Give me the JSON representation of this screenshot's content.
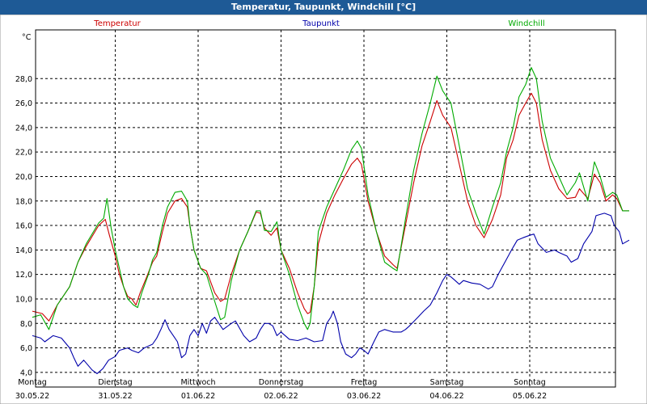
{
  "window": {
    "title": "Temperatur, Taupunkt, Windchill [°C]"
  },
  "chart_data": {
    "type": "line",
    "unit_label": "°C",
    "ylim": [
      3.0,
      30.5
    ],
    "y_ticks": [
      4.0,
      6.0,
      8.0,
      10.0,
      12.0,
      14.0,
      16.0,
      18.0,
      20.0,
      22.0,
      24.0,
      26.0,
      28.0
    ],
    "y_tick_labels": [
      "4,0",
      "6,0",
      "8,0",
      "10,0",
      "12,0",
      "14,0",
      "16,0",
      "18,0",
      "20,0",
      "22,0",
      "24,0",
      "26,0",
      "28,0"
    ],
    "xlim": [
      0,
      7.1
    ],
    "x_ticks": [
      {
        "x": 0,
        "day": "Montag",
        "date": "30.05.22"
      },
      {
        "x": 1,
        "day": "Dienstag",
        "date": "31.05.22"
      },
      {
        "x": 2,
        "day": "Mittwoch",
        "date": "01.06.22"
      },
      {
        "x": 3,
        "day": "Donnerstag",
        "date": "02.06.22"
      },
      {
        "x": 4,
        "day": "Freitag",
        "date": "03.06.22"
      },
      {
        "x": 5,
        "day": "Samstag",
        "date": "04.06.22"
      },
      {
        "x": 6,
        "day": "Sonntag",
        "date": "05.06.22"
      }
    ],
    "grid": true,
    "legend_placement": "top",
    "series": [
      {
        "name": "Temperatur",
        "color": "#cc0000",
        "points": [
          [
            0,
            9.0
          ],
          [
            0.12,
            8.8
          ],
          [
            0.2,
            8.2
          ],
          [
            0.3,
            9.5
          ],
          [
            0.45,
            11.0
          ],
          [
            0.55,
            13.0
          ],
          [
            0.65,
            14.3
          ],
          [
            0.8,
            16.0
          ],
          [
            0.88,
            16.5
          ],
          [
            0.93,
            15.2
          ],
          [
            1.0,
            13.5
          ],
          [
            1.05,
            12.0
          ],
          [
            1.1,
            11.0
          ],
          [
            1.15,
            10.2
          ],
          [
            1.2,
            10.0
          ],
          [
            1.25,
            9.5
          ],
          [
            1.3,
            10.5
          ],
          [
            1.38,
            11.8
          ],
          [
            1.45,
            13.0
          ],
          [
            1.5,
            13.5
          ],
          [
            1.57,
            15.5
          ],
          [
            1.63,
            17.0
          ],
          [
            1.72,
            18.0
          ],
          [
            1.8,
            18.2
          ],
          [
            1.87,
            17.5
          ],
          [
            1.9,
            16.0
          ],
          [
            1.95,
            14.0
          ],
          [
            2.03,
            12.5
          ],
          [
            2.1,
            12.3
          ],
          [
            2.2,
            10.5
          ],
          [
            2.27,
            9.8
          ],
          [
            2.32,
            10.0
          ],
          [
            2.4,
            12.0
          ],
          [
            2.5,
            14.0
          ],
          [
            2.6,
            15.5
          ],
          [
            2.7,
            17.1
          ],
          [
            2.75,
            17.0
          ],
          [
            2.8,
            15.8
          ],
          [
            2.88,
            15.2
          ],
          [
            2.95,
            15.8
          ],
          [
            3.0,
            14.0
          ],
          [
            3.1,
            12.5
          ],
          [
            3.2,
            10.5
          ],
          [
            3.28,
            9.2
          ],
          [
            3.32,
            8.8
          ],
          [
            3.35,
            8.9
          ],
          [
            3.4,
            11.0
          ],
          [
            3.45,
            14.5
          ],
          [
            3.55,
            17.0
          ],
          [
            3.65,
            18.5
          ],
          [
            3.75,
            19.8
          ],
          [
            3.85,
            21.0
          ],
          [
            3.92,
            21.5
          ],
          [
            3.97,
            21.0
          ],
          [
            4.05,
            18.0
          ],
          [
            4.15,
            15.5
          ],
          [
            4.25,
            13.5
          ],
          [
            4.35,
            12.8
          ],
          [
            4.4,
            12.5
          ],
          [
            4.5,
            16.0
          ],
          [
            4.6,
            19.5
          ],
          [
            4.7,
            22.5
          ],
          [
            4.8,
            24.5
          ],
          [
            4.88,
            26.2
          ],
          [
            4.95,
            25.0
          ],
          [
            5.05,
            24.0
          ],
          [
            5.15,
            21.0
          ],
          [
            5.25,
            18.0
          ],
          [
            5.35,
            16.0
          ],
          [
            5.45,
            15.0
          ],
          [
            5.55,
            16.5
          ],
          [
            5.65,
            18.5
          ],
          [
            5.72,
            21.5
          ],
          [
            5.8,
            23.0
          ],
          [
            5.87,
            25.0
          ],
          [
            5.95,
            26.0
          ],
          [
            6.02,
            26.8
          ],
          [
            6.08,
            26.0
          ],
          [
            6.15,
            23.0
          ],
          [
            6.25,
            20.5
          ],
          [
            6.35,
            19.0
          ],
          [
            6.45,
            18.2
          ],
          [
            6.55,
            18.3
          ],
          [
            6.6,
            19.0
          ],
          [
            6.7,
            18.2
          ],
          [
            6.78,
            20.2
          ],
          [
            6.85,
            19.5
          ],
          [
            6.92,
            18.0
          ],
          [
            7.0,
            18.5
          ],
          [
            7.05,
            18.2
          ],
          [
            7.12,
            17.2
          ],
          [
            7.2,
            17.2
          ]
        ]
      },
      {
        "name": "Taupunkt",
        "color": "#0000aa",
        "points": [
          [
            0,
            7.0
          ],
          [
            0.1,
            6.8
          ],
          [
            0.15,
            6.5
          ],
          [
            0.25,
            7.0
          ],
          [
            0.35,
            6.8
          ],
          [
            0.45,
            6.0
          ],
          [
            0.5,
            5.2
          ],
          [
            0.55,
            4.5
          ],
          [
            0.62,
            5.0
          ],
          [
            0.72,
            4.2
          ],
          [
            0.78,
            3.9
          ],
          [
            0.85,
            4.3
          ],
          [
            0.92,
            5.0
          ],
          [
            1.0,
            5.3
          ],
          [
            1.05,
            5.8
          ],
          [
            1.15,
            6.0
          ],
          [
            1.2,
            5.8
          ],
          [
            1.28,
            5.6
          ],
          [
            1.35,
            6.0
          ],
          [
            1.45,
            6.3
          ],
          [
            1.5,
            6.8
          ],
          [
            1.55,
            7.5
          ],
          [
            1.6,
            8.3
          ],
          [
            1.65,
            7.5
          ],
          [
            1.7,
            7.0
          ],
          [
            1.75,
            6.5
          ],
          [
            1.8,
            5.2
          ],
          [
            1.85,
            5.5
          ],
          [
            1.9,
            7.0
          ],
          [
            1.95,
            7.5
          ],
          [
            2.0,
            7.0
          ],
          [
            2.05,
            8.0
          ],
          [
            2.1,
            7.2
          ],
          [
            2.15,
            8.2
          ],
          [
            2.2,
            8.5
          ],
          [
            2.25,
            8.0
          ],
          [
            2.3,
            7.5
          ],
          [
            2.4,
            8.0
          ],
          [
            2.45,
            8.2
          ],
          [
            2.55,
            7.0
          ],
          [
            2.62,
            6.5
          ],
          [
            2.7,
            6.8
          ],
          [
            2.75,
            7.5
          ],
          [
            2.8,
            8.0
          ],
          [
            2.85,
            8.0
          ],
          [
            2.9,
            7.8
          ],
          [
            2.95,
            7.0
          ],
          [
            3.0,
            7.3
          ],
          [
            3.1,
            6.7
          ],
          [
            3.2,
            6.6
          ],
          [
            3.3,
            6.8
          ],
          [
            3.4,
            6.5
          ],
          [
            3.5,
            6.6
          ],
          [
            3.55,
            8.0
          ],
          [
            3.6,
            8.5
          ],
          [
            3.63,
            9.0
          ],
          [
            3.68,
            8.0
          ],
          [
            3.72,
            6.5
          ],
          [
            3.78,
            5.5
          ],
          [
            3.85,
            5.2
          ],
          [
            3.9,
            5.5
          ],
          [
            3.95,
            6.0
          ],
          [
            4.0,
            5.8
          ],
          [
            4.05,
            5.5
          ],
          [
            4.12,
            6.5
          ],
          [
            4.18,
            7.3
          ],
          [
            4.25,
            7.5
          ],
          [
            4.35,
            7.3
          ],
          [
            4.45,
            7.3
          ],
          [
            4.5,
            7.5
          ],
          [
            4.55,
            7.8
          ],
          [
            4.65,
            8.5
          ],
          [
            4.72,
            9.0
          ],
          [
            4.8,
            9.5
          ],
          [
            4.88,
            10.5
          ],
          [
            4.95,
            11.5
          ],
          [
            5.0,
            12.0
          ],
          [
            5.05,
            11.8
          ],
          [
            5.1,
            11.5
          ],
          [
            5.15,
            11.2
          ],
          [
            5.2,
            11.5
          ],
          [
            5.3,
            11.3
          ],
          [
            5.4,
            11.2
          ],
          [
            5.5,
            10.8
          ],
          [
            5.55,
            11.0
          ],
          [
            5.62,
            12.0
          ],
          [
            5.7,
            13.0
          ],
          [
            5.78,
            14.0
          ],
          [
            5.85,
            14.8
          ],
          [
            5.92,
            15.0
          ],
          [
            6.0,
            15.2
          ],
          [
            6.05,
            15.3
          ],
          [
            6.1,
            14.5
          ],
          [
            6.2,
            13.8
          ],
          [
            6.3,
            14.0
          ],
          [
            6.35,
            13.8
          ],
          [
            6.45,
            13.5
          ],
          [
            6.5,
            13.0
          ],
          [
            6.58,
            13.3
          ],
          [
            6.65,
            14.5
          ],
          [
            6.75,
            15.5
          ],
          [
            6.8,
            16.8
          ],
          [
            6.9,
            17.0
          ],
          [
            6.98,
            16.8
          ],
          [
            7.02,
            16.0
          ],
          [
            7.08,
            15.5
          ],
          [
            7.12,
            14.5
          ],
          [
            7.2,
            14.8
          ]
        ]
      },
      {
        "name": "Windchill",
        "color": "#00aa00",
        "points": [
          [
            0,
            8.5
          ],
          [
            0.1,
            8.7
          ],
          [
            0.2,
            7.5
          ],
          [
            0.3,
            9.5
          ],
          [
            0.45,
            11.0
          ],
          [
            0.55,
            13.0
          ],
          [
            0.65,
            14.5
          ],
          [
            0.8,
            16.2
          ],
          [
            0.86,
            16.6
          ],
          [
            0.9,
            18.2
          ],
          [
            0.95,
            15.8
          ],
          [
            1.0,
            14.0
          ],
          [
            1.05,
            12.5
          ],
          [
            1.1,
            11.0
          ],
          [
            1.15,
            10.0
          ],
          [
            1.22,
            9.5
          ],
          [
            1.27,
            9.3
          ],
          [
            1.32,
            10.5
          ],
          [
            1.4,
            12.0
          ],
          [
            1.45,
            13.2
          ],
          [
            1.5,
            13.8
          ],
          [
            1.57,
            16.0
          ],
          [
            1.63,
            17.5
          ],
          [
            1.72,
            18.7
          ],
          [
            1.8,
            18.8
          ],
          [
            1.87,
            18.0
          ],
          [
            1.9,
            16.0
          ],
          [
            1.95,
            14.0
          ],
          [
            2.03,
            12.5
          ],
          [
            2.1,
            12.0
          ],
          [
            2.2,
            9.8
          ],
          [
            2.27,
            8.3
          ],
          [
            2.32,
            8.5
          ],
          [
            2.4,
            11.5
          ],
          [
            2.5,
            14.0
          ],
          [
            2.6,
            15.5
          ],
          [
            2.7,
            17.2
          ],
          [
            2.75,
            17.2
          ],
          [
            2.8,
            15.6
          ],
          [
            2.88,
            15.5
          ],
          [
            2.95,
            16.3
          ],
          [
            3.0,
            14.0
          ],
          [
            3.1,
            12.0
          ],
          [
            3.2,
            9.5
          ],
          [
            3.28,
            8.0
          ],
          [
            3.32,
            7.5
          ],
          [
            3.35,
            8.0
          ],
          [
            3.4,
            11.0
          ],
          [
            3.45,
            15.5
          ],
          [
            3.55,
            17.5
          ],
          [
            3.65,
            19.0
          ],
          [
            3.75,
            20.5
          ],
          [
            3.85,
            22.2
          ],
          [
            3.92,
            22.9
          ],
          [
            3.97,
            22.3
          ],
          [
            4.05,
            18.5
          ],
          [
            4.15,
            15.5
          ],
          [
            4.25,
            13.0
          ],
          [
            4.35,
            12.5
          ],
          [
            4.4,
            12.3
          ],
          [
            4.5,
            16.5
          ],
          [
            4.6,
            20.5
          ],
          [
            4.7,
            23.5
          ],
          [
            4.8,
            26.0
          ],
          [
            4.88,
            28.2
          ],
          [
            4.95,
            27.0
          ],
          [
            5.05,
            26.0
          ],
          [
            5.15,
            22.5
          ],
          [
            5.25,
            19.0
          ],
          [
            5.35,
            17.0
          ],
          [
            5.45,
            15.3
          ],
          [
            5.55,
            17.5
          ],
          [
            5.65,
            19.5
          ],
          [
            5.72,
            22.0
          ],
          [
            5.8,
            24.0
          ],
          [
            5.87,
            26.5
          ],
          [
            5.95,
            27.5
          ],
          [
            6.02,
            28.9
          ],
          [
            6.08,
            28.0
          ],
          [
            6.15,
            24.5
          ],
          [
            6.25,
            21.5
          ],
          [
            6.35,
            20.0
          ],
          [
            6.45,
            18.5
          ],
          [
            6.55,
            19.5
          ],
          [
            6.6,
            20.3
          ],
          [
            6.7,
            18.0
          ],
          [
            6.78,
            21.2
          ],
          [
            6.85,
            20.0
          ],
          [
            6.92,
            18.3
          ],
          [
            7.0,
            18.7
          ],
          [
            7.05,
            18.5
          ],
          [
            7.12,
            17.2
          ],
          [
            7.2,
            17.2
          ]
        ]
      }
    ]
  }
}
